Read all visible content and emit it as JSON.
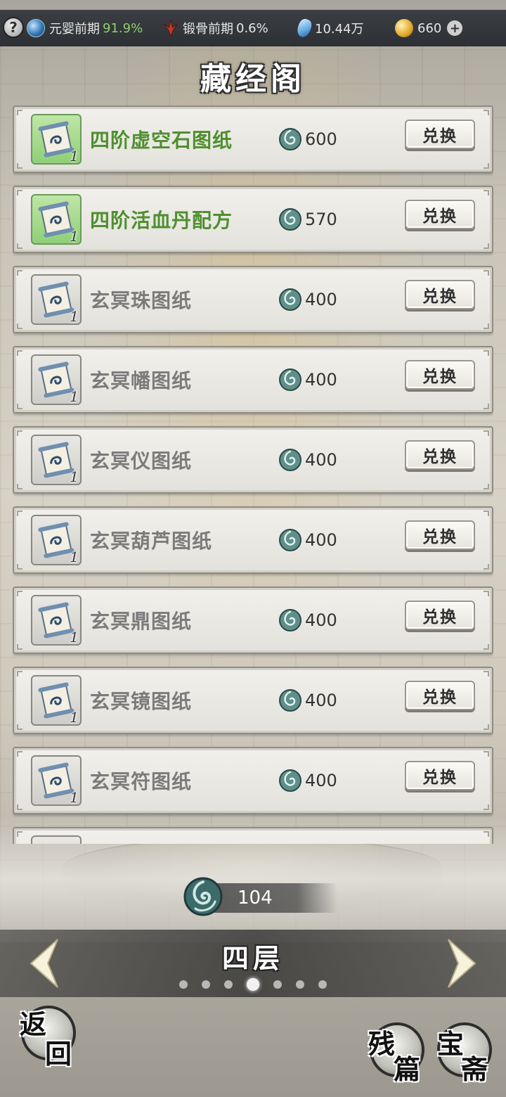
{
  "status_bar": {
    "cultivation_label": "元婴前期",
    "cultivation_pct": "91.9%",
    "body_label": "锻骨前期",
    "body_pct": "0.6%",
    "spirit_stones": "10.44万",
    "coins": "660",
    "help_label": "?",
    "plus_label": "+"
  },
  "title": "藏经阁",
  "items": [
    {
      "name": "四阶虚空石图纸",
      "price": "600",
      "qty": "1",
      "rare": true
    },
    {
      "name": "四阶活血丹配方",
      "price": "570",
      "qty": "1",
      "rare": true
    },
    {
      "name": "玄冥珠图纸",
      "price": "400",
      "qty": "1",
      "rare": false
    },
    {
      "name": "玄冥幡图纸",
      "price": "400",
      "qty": "1",
      "rare": false
    },
    {
      "name": "玄冥仪图纸",
      "price": "400",
      "qty": "1",
      "rare": false
    },
    {
      "name": "玄冥葫芦图纸",
      "price": "400",
      "qty": "1",
      "rare": false
    },
    {
      "name": "玄冥鼎图纸",
      "price": "400",
      "qty": "1",
      "rare": false
    },
    {
      "name": "玄冥镜图纸",
      "price": "400",
      "qty": "1",
      "rare": false
    },
    {
      "name": "玄冥符图纸",
      "price": "400",
      "qty": "1",
      "rare": false
    },
    {
      "name": "",
      "price": "",
      "qty": "",
      "rare": false
    }
  ],
  "exchange_label": "兑换",
  "currency_balance": "104",
  "floor": {
    "label": "四层",
    "page_count": 7,
    "active_page": 4
  },
  "buttons": {
    "return_chars": [
      "返",
      "回"
    ],
    "fragment_chars": [
      "残",
      "篇"
    ],
    "treasure_chars": [
      "宝",
      "斋"
    ]
  }
}
